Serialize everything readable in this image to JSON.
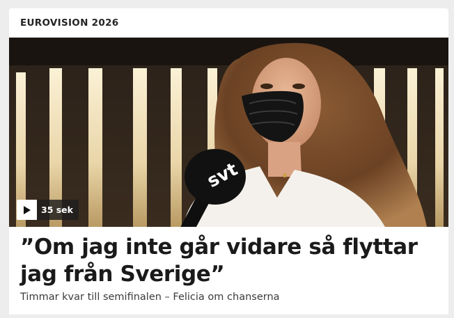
{
  "section": {
    "label": "EUROVISION 2026"
  },
  "video": {
    "duration_label": "35 sek",
    "play_icon": "play-icon",
    "mic_logo": "svt"
  },
  "article": {
    "headline": "”Om jag inte går vidare så flyttar jag från Sverige”",
    "subtitle": "Timmar kvar till semifinalen – Felicia om chanserna"
  },
  "colors": {
    "page_bg": "#ededed",
    "card_bg": "#ffffff",
    "headline": "#1a1a1a",
    "badge_bg": "#1e1e1e"
  }
}
